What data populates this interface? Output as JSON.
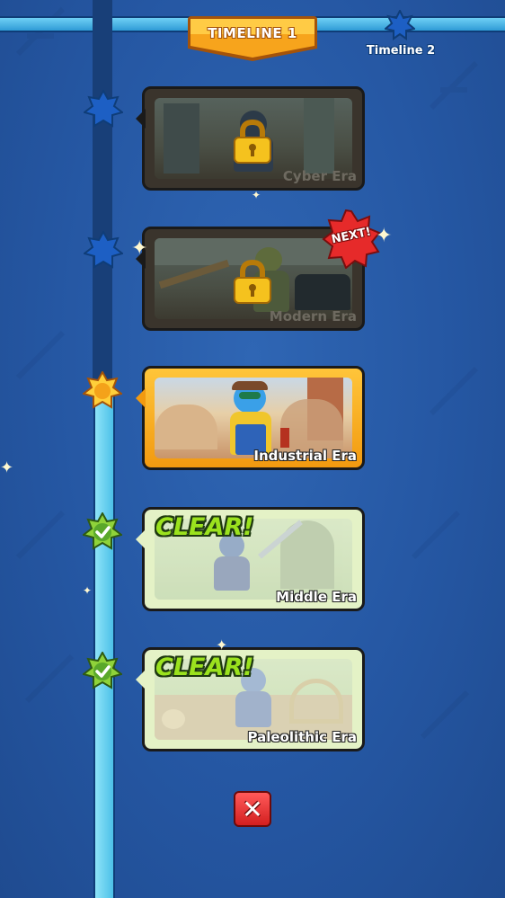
{
  "timeline": {
    "active_tab": "TIMELINE 1",
    "next_tab": "Timeline 2"
  },
  "eras": [
    {
      "name": "Cyber Era",
      "state": "locked"
    },
    {
      "name": "Modern Era",
      "state": "locked",
      "badge": "NEXT!"
    },
    {
      "name": "Industrial Era",
      "state": "current"
    },
    {
      "name": "Middle Era",
      "state": "cleared",
      "status_text": "CLEAR!"
    },
    {
      "name": "Paleolithic Era",
      "state": "cleared",
      "status_text": "CLEAR!"
    }
  ],
  "close_button": {
    "icon": "close-icon"
  },
  "colors": {
    "background": "#2557a3",
    "track_active": "#4cc0e8",
    "tab_gold": "#f7a41c",
    "clear_green": "#9be21e",
    "close_red": "#d31f1f"
  }
}
